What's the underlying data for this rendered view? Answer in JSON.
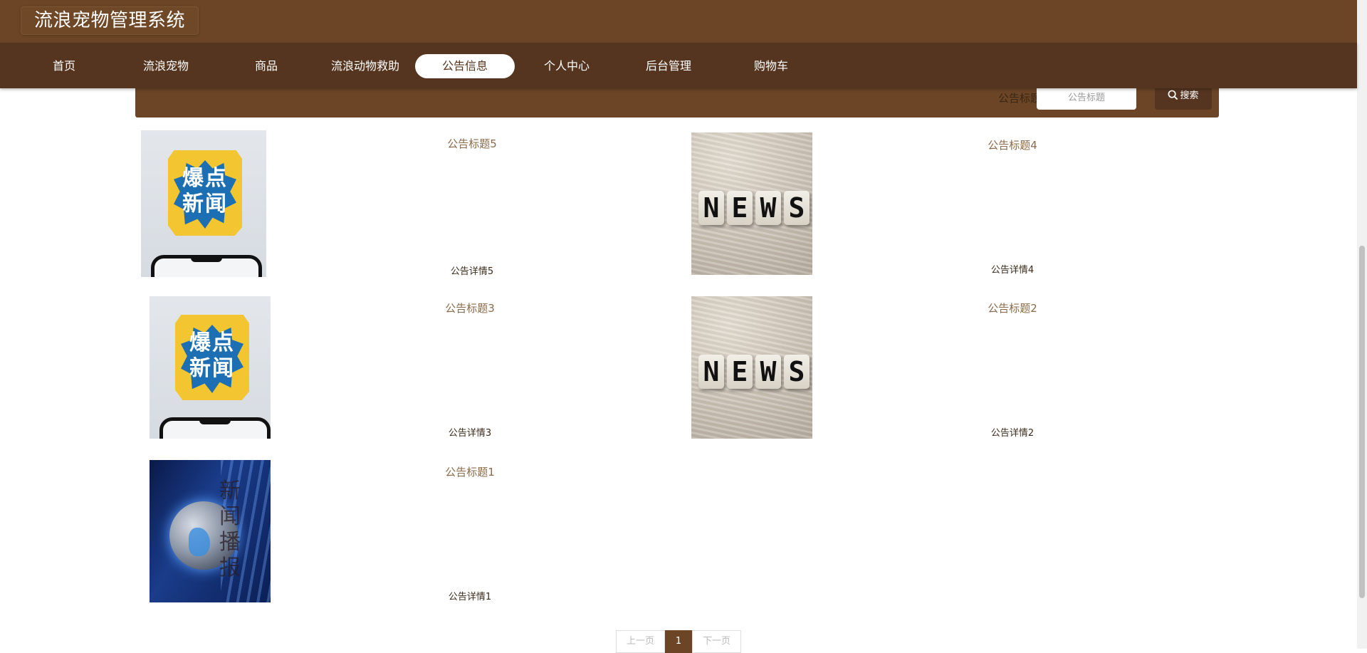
{
  "app": {
    "title": "流浪宠物管理系统"
  },
  "nav": {
    "items": [
      {
        "label": "首页"
      },
      {
        "label": "流浪宠物"
      },
      {
        "label": "商品"
      },
      {
        "label": "流浪动物救助"
      },
      {
        "label": "公告信息",
        "active": true
      },
      {
        "label": "个人中心"
      },
      {
        "label": "后台管理"
      },
      {
        "label": "购物车"
      }
    ]
  },
  "search": {
    "label": "公告标题",
    "placeholder": "公告标题",
    "button_label": "搜索"
  },
  "news": [
    {
      "title": "公告标题5",
      "detail": "公告详情5",
      "thumb": "爆点新闻"
    },
    {
      "title": "公告标题4",
      "detail": "公告详情4",
      "thumb": "NEWS"
    },
    {
      "title": "公告标题3",
      "detail": "公告详情3",
      "thumb": "爆点新闻"
    },
    {
      "title": "公告标题2",
      "detail": "公告详情2",
      "thumb": "NEWS"
    },
    {
      "title": "公告标题1",
      "detail": "公告详情1",
      "thumb": "新闻播报"
    }
  ],
  "thumb_text": {
    "baodian_line1": "爆点",
    "baodian_line2": "新闻",
    "news_letters": [
      "N",
      "E",
      "W",
      "S"
    ],
    "globe_vertical": "新闻播报"
  },
  "pagination": {
    "prev": "上一页",
    "current": "1",
    "next": "下一页"
  },
  "colors": {
    "header": "#6b4526",
    "nav": "#553520",
    "title_text": "#8a6a4a"
  }
}
